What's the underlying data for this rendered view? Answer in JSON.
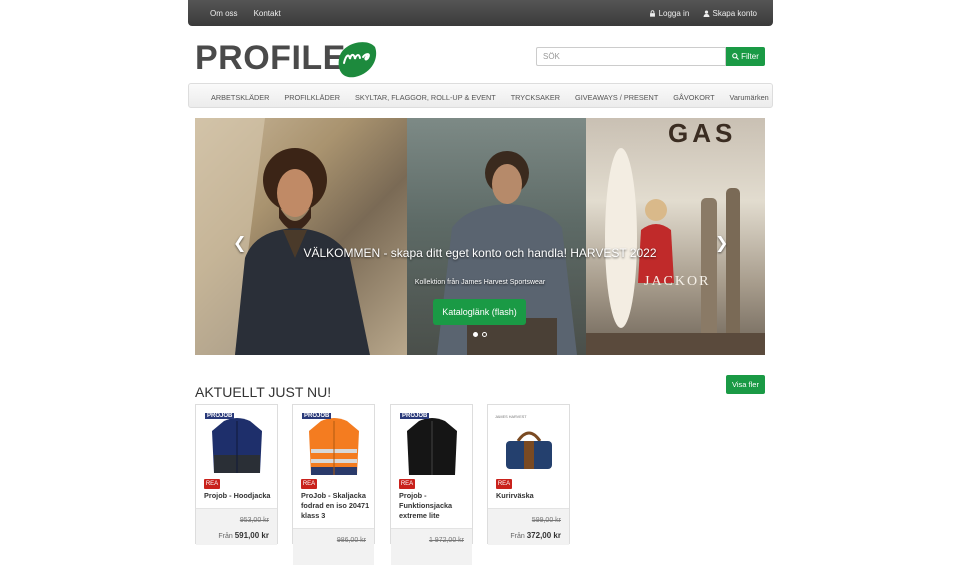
{
  "topbar": {
    "left_links": [
      "Om oss",
      "Kontakt"
    ],
    "login": "Logga in",
    "register": "Skapa konto"
  },
  "logo": {
    "text": "PROFILE",
    "mark": "me"
  },
  "search": {
    "placeholder": "SÖK",
    "button_label": "Filter"
  },
  "nav": {
    "items": [
      "ARBETSKLÄDER",
      "PROFILKLÄDER",
      "SKYLTAR, FLAGGOR, ROLL-UP & EVENT",
      "TRYCKSAKER",
      "GIVEAWAYS / PRESENT",
      "GÅVOKORT",
      "Varumärken"
    ]
  },
  "hero": {
    "caption": "VÄLKOMMEN - skapa ditt eget konto och handla! HARVEST 2022",
    "subcaption": "Kollektion från James Harvest Sportswear",
    "button_label": "Kataloglänk (flash)",
    "sign_text": "GAS",
    "panel_text": "JACKOR",
    "prev_icon": "chevron-left-icon",
    "next_icon": "chevron-right-icon"
  },
  "section": {
    "title": "AKTUELLT JUST NU!",
    "more_label": "Visa fler"
  },
  "products": [
    {
      "brand": "PROJOB",
      "badge": "REA",
      "name": "Projob - Hoodjacka",
      "old_price": "953,00 kr",
      "from_label": "Från",
      "price": "591,00 kr"
    },
    {
      "brand": "PROJOB",
      "badge": "REA",
      "name": "ProJob - Skaljacka fodrad en iso 20471 klass 3",
      "old_price": "986,00 kr",
      "from_label": "",
      "price": ""
    },
    {
      "brand": "PROJOB",
      "badge": "REA",
      "name": "Projob - Funktionsjacka extreme lite",
      "old_price": "1 972,00 kr",
      "from_label": "",
      "price": ""
    },
    {
      "brand": "JAMES HARVEST",
      "badge": "REA",
      "name": "Kurirväska",
      "old_price": "599,00 kr",
      "from_label": "Från",
      "price": "372,00 kr"
    }
  ],
  "colors": {
    "accent": "#1a9a45",
    "sale": "#c9221c",
    "topbar": "#3a3a3a"
  }
}
